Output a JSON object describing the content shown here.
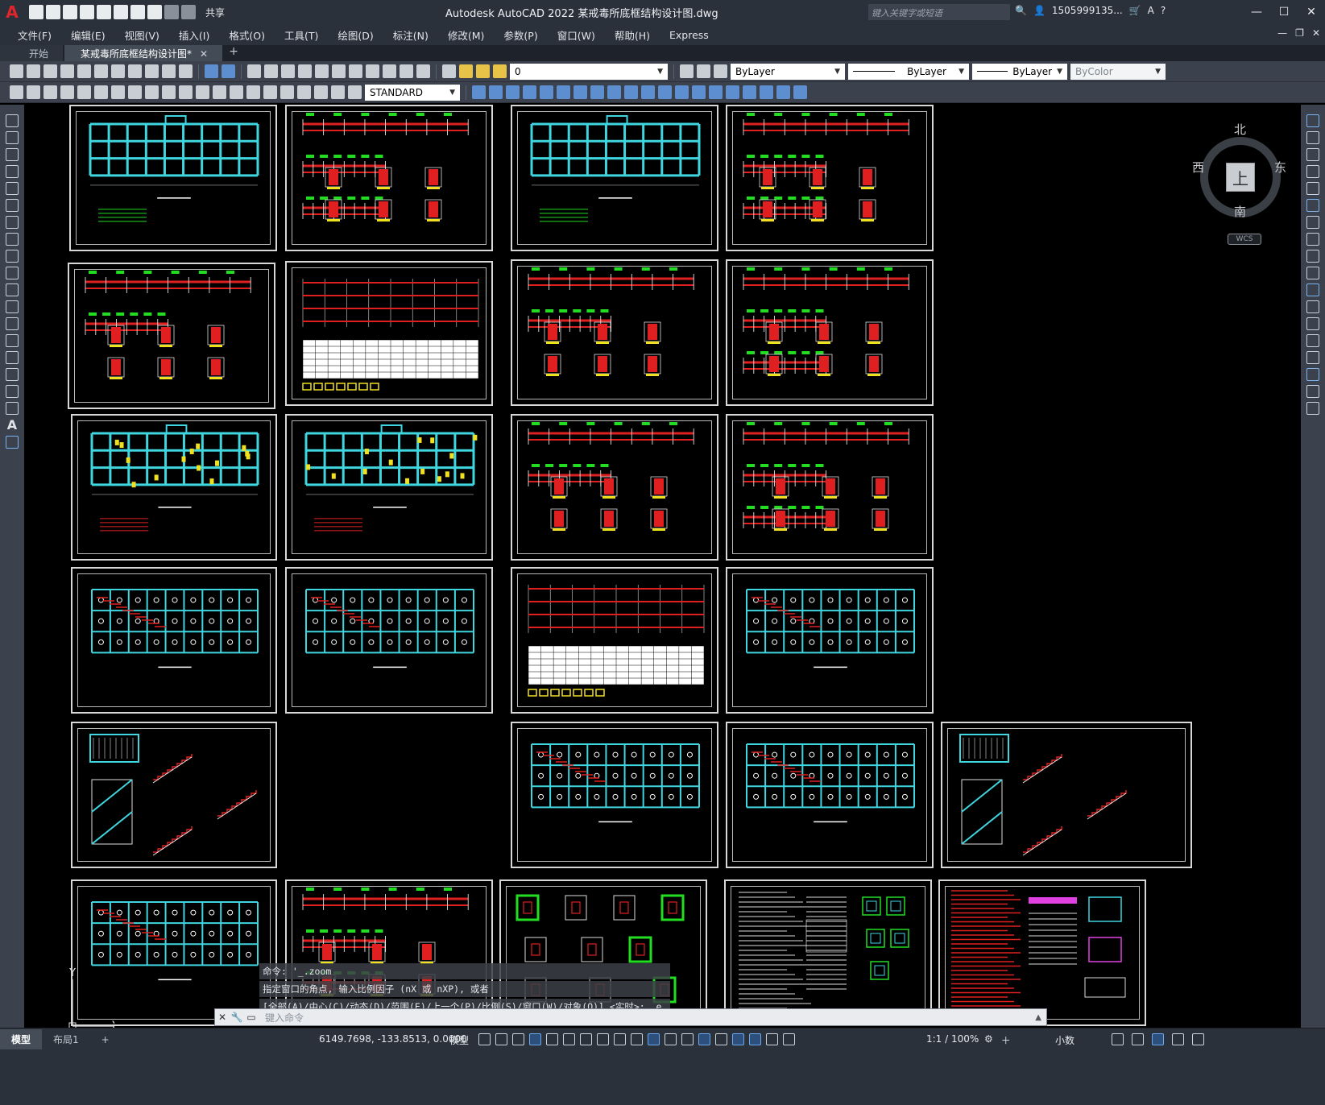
{
  "app": {
    "logo": "A",
    "title": "Autodesk AutoCAD 2022    某戒毒所底框结构设计图.dwg",
    "share_label": "共享",
    "search_placeholder": "键入关键字或短语",
    "user_name": "1505999135...",
    "window_controls": [
      "—",
      "☐",
      "✕"
    ]
  },
  "menu": {
    "items": [
      "文件(F)",
      "编辑(E)",
      "视图(V)",
      "插入(I)",
      "格式(O)",
      "工具(T)",
      "绘图(D)",
      "标注(N)",
      "修改(M)",
      "参数(P)",
      "窗口(W)",
      "帮助(H)",
      "Express"
    ]
  },
  "tabs": {
    "start": "开始",
    "active": "某戒毒所底框结构设计图*",
    "close": "✕",
    "add": "+"
  },
  "toolbar1": {
    "layer_value": "0",
    "color_value": "ByLayer",
    "linetype_value": "ByLayer",
    "lineweight_value": "ByLayer",
    "plotstyle_value": "ByColor"
  },
  "toolbar2": {
    "textstyle_value": "STANDARD"
  },
  "viewcube": {
    "north": "北",
    "south": "南",
    "east": "东",
    "west": "西",
    "face": "上",
    "wcs": "WCS"
  },
  "ucs": {
    "x": "X",
    "y": "Y"
  },
  "command": {
    "history": [
      "命令: '_.zoom",
      "指定窗口的角点, 输入比例因子 (nX 或 nXP), 或者",
      "[全部(A)/中心(C)/动态(D)/范围(E)/上一个(P)/比例(S)/窗口(W)/对象(O)] <实时>: _e"
    ],
    "placeholder": "键入命令"
  },
  "status": {
    "model_tab": "模型",
    "layout_tab": "布局1",
    "add_tab": "+",
    "coordinates": "6149.7698, -133.8513, 0.0000",
    "space": "模型",
    "scale": "1:1 / 100%",
    "units": "小数"
  },
  "colors": {
    "background": "#000000",
    "chrome": "#2b313b",
    "toolbar": "#3b424d",
    "cyan": "#3fd6e0",
    "red": "#e02020",
    "green": "#22dd22",
    "yellow": "#f0e020",
    "magenta": "#e040e0"
  },
  "icons": {
    "search": "search-icon",
    "user": "user-icon",
    "cart": "cart-icon",
    "help": "help-icon",
    "grid": "grid-icon",
    "snap": "snap-icon",
    "settings": "gear-icon"
  }
}
